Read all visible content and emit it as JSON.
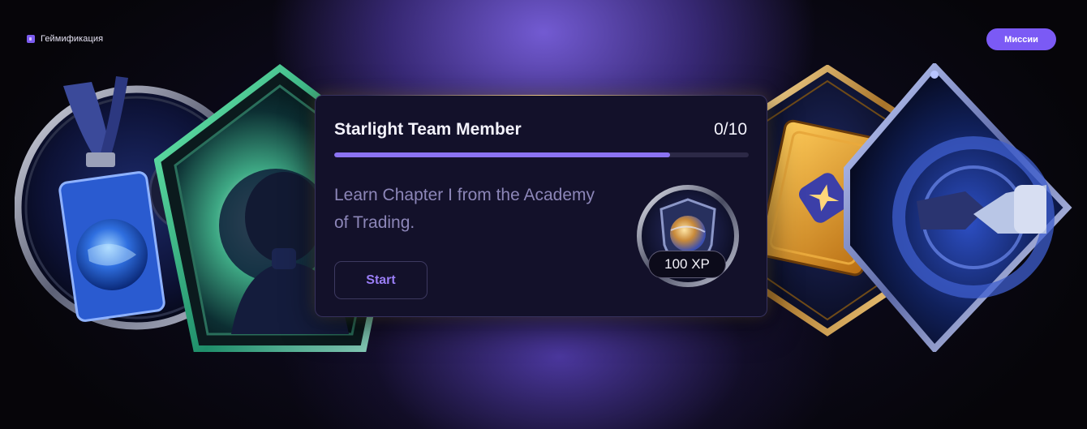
{
  "header": {
    "brand_label": "Геймификация",
    "missions_button": "Миссии"
  },
  "badges": [
    {
      "name": "lanyard-badge",
      "icon": "id-card-icon"
    },
    {
      "name": "astronaut-pentagon-badge",
      "icon": "astronaut-icon"
    },
    {
      "name": "golden-book-badge",
      "icon": "book-icon"
    },
    {
      "name": "handshake-diamond-badge",
      "icon": "handshake-icon"
    }
  ],
  "mission": {
    "title": "Starlight Team Member",
    "progress_text": "0/10",
    "progress_fraction": 0.81,
    "description": "Learn Chapter I from the Academy of Trading.",
    "start_label": "Start",
    "reward_label": "100 XP",
    "reward_icon": "shield-planet-icon"
  },
  "colors": {
    "accent": "#7b5af5",
    "progress_fill": "#8b73f2",
    "card_bg": "#13112a"
  }
}
